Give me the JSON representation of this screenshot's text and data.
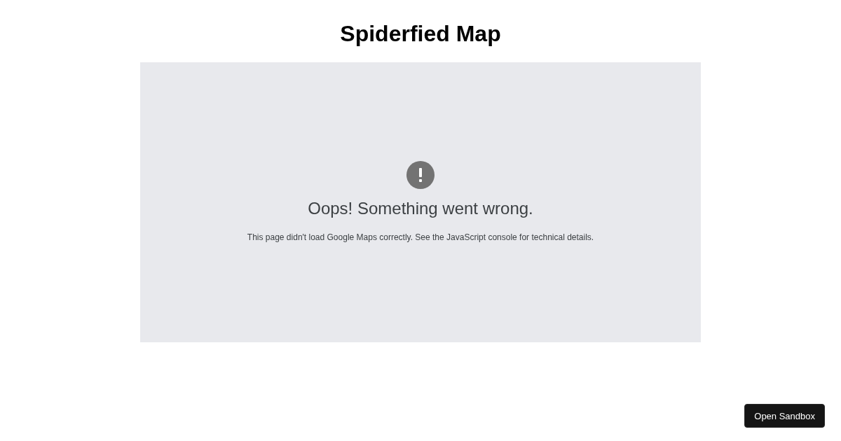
{
  "page": {
    "title": "Spiderfied Map"
  },
  "map": {
    "error_title": "Oops! Something went wrong.",
    "error_message": "This page didn't load Google Maps correctly. See the JavaScript console for technical details."
  },
  "sandbox_button": {
    "label": "Open Sandbox"
  }
}
